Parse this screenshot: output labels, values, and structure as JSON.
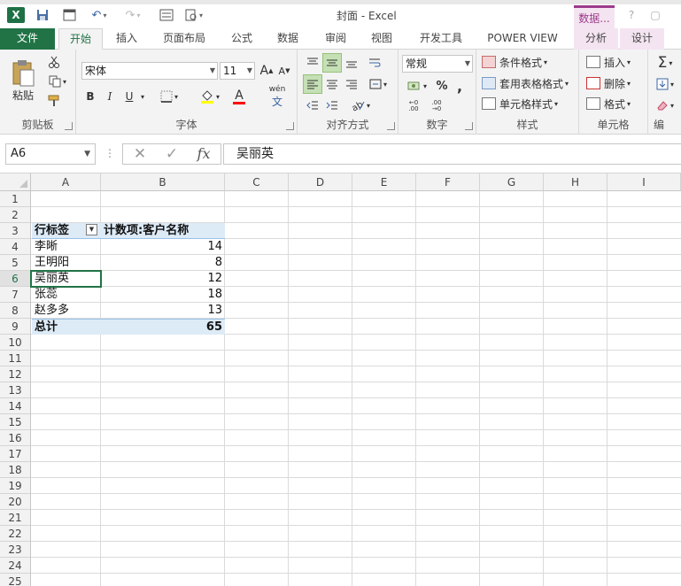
{
  "window": {
    "title": "封面 - Excel",
    "context_tab_group": "数据...",
    "help": "?",
    "restore": "▢",
    "logo": "X"
  },
  "tabs": [
    {
      "label": "文件"
    },
    {
      "label": "开始"
    },
    {
      "label": "插入"
    },
    {
      "label": "页面布局"
    },
    {
      "label": "公式"
    },
    {
      "label": "数据"
    },
    {
      "label": "审阅"
    },
    {
      "label": "视图"
    },
    {
      "label": "开发工具"
    },
    {
      "label": "POWER VIEW"
    },
    {
      "label": "分析"
    },
    {
      "label": "设计"
    }
  ],
  "ribbon": {
    "clipboard": {
      "label": "剪贴板",
      "paste": "粘贴"
    },
    "font": {
      "label": "字体",
      "font_name": "宋体",
      "font_size": "11",
      "bold": "B",
      "italic": "I",
      "underline": "U",
      "increase": "A",
      "decrease": "A",
      "font_color": "A",
      "phonetic": "wén"
    },
    "alignment": {
      "label": "对齐方式"
    },
    "number": {
      "label": "数字",
      "format": "常规",
      "percent": "%",
      "comma": ","
    },
    "styles": {
      "label": "样式",
      "conditional": "条件格式",
      "table": "套用表格格式",
      "cell_styles": "单元格样式"
    },
    "cells": {
      "label": "单元格",
      "insert": "插入",
      "delete": "删除",
      "format": "格式"
    },
    "editing": {
      "label": "编",
      "sum": "Σ"
    }
  },
  "formula_bar": {
    "name_box": "A6",
    "value": "吴丽英",
    "fx": "fx",
    "cancel": "✕",
    "enter": "✓"
  },
  "columns": [
    "A",
    "B",
    "C",
    "D",
    "E",
    "F",
    "G",
    "H",
    "I"
  ],
  "rows": [
    "1",
    "2",
    "3",
    "4",
    "5",
    "6",
    "7",
    "8",
    "9",
    "10",
    "11",
    "12",
    "13",
    "14",
    "15",
    "16",
    "17",
    "18",
    "19",
    "20",
    "21",
    "22",
    "23",
    "24",
    "25"
  ],
  "pivot": {
    "row_label_header": "行标签",
    "value_header": "计数项:客户名称",
    "items": [
      {
        "name": "李晰",
        "count": "14"
      },
      {
        "name": "王明阳",
        "count": "8"
      },
      {
        "name": "吴丽英",
        "count": "12"
      },
      {
        "name": "张蕊",
        "count": "18"
      },
      {
        "name": "赵多多",
        "count": "13"
      }
    ],
    "total_label": "总计",
    "total_value": "65"
  }
}
